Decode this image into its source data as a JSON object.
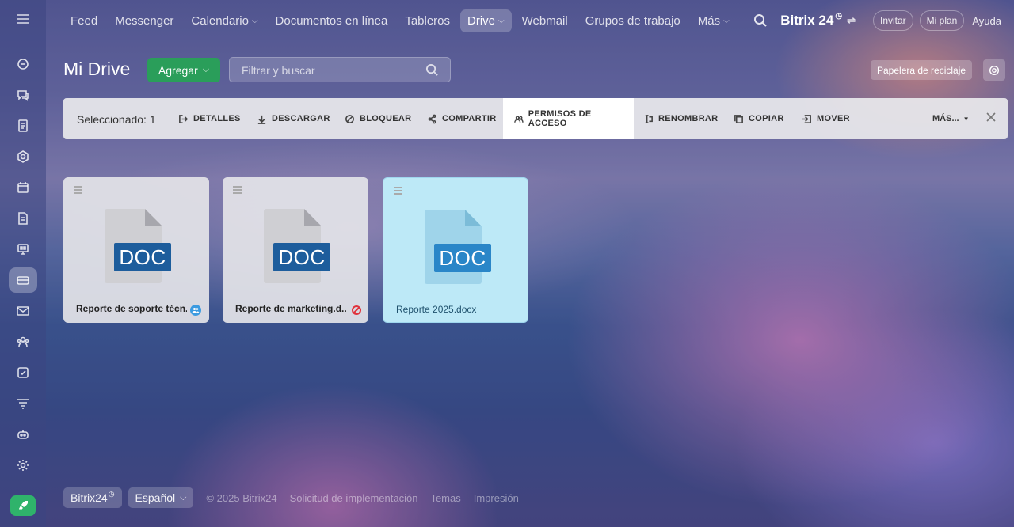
{
  "nav": {
    "items": [
      {
        "label": "Feed",
        "chevron": false
      },
      {
        "label": "Messenger",
        "chevron": false
      },
      {
        "label": "Calendario",
        "chevron": true
      },
      {
        "label": "Documentos en línea",
        "chevron": false
      },
      {
        "label": "Tableros",
        "chevron": false
      },
      {
        "label": "Drive",
        "chevron": true,
        "active": true
      },
      {
        "label": "Webmail",
        "chevron": false
      },
      {
        "label": "Grupos de trabajo",
        "chevron": false
      },
      {
        "label": "Más",
        "chevron": true
      }
    ],
    "brand": "Bitrix 24",
    "invite": "Invitar",
    "my_plan": "Mi plan",
    "help": "Ayuda"
  },
  "sidebar": {
    "icons": [
      "menu-icon",
      "feed-icon",
      "chat-icon",
      "docs-icon",
      "sites-icon",
      "calendar-icon",
      "document-icon",
      "boards-icon",
      "drive-icon",
      "mail-icon",
      "groups-icon",
      "tasks-icon",
      "filter-icon",
      "robot-icon",
      "settings-icon"
    ],
    "active": "drive-icon"
  },
  "page": {
    "title": "Mi Drive",
    "add_button": "Agregar",
    "filter_placeholder": "Filtrar y buscar",
    "trash_button": "Papelera de reciclaje"
  },
  "toolbar": {
    "selected_label": "Seleccionado: 1",
    "actions": {
      "details": "DETALLES",
      "download": "DESCARGAR",
      "lock": "BLOQUEAR",
      "share": "COMPARTIR",
      "permissions": "PERMISOS DE ACCESO",
      "rename": "RENOMBRAR",
      "copy": "COPIAR",
      "move": "MOVER"
    },
    "more": "MÁS..."
  },
  "files": [
    {
      "name": "Reporte de soporte técn...",
      "type": "DOC",
      "status": "shared",
      "selected": false
    },
    {
      "name": "Reporte de marketing.d...",
      "type": "DOC",
      "status": "locked",
      "selected": false
    },
    {
      "name": "Reporte 2025.docx",
      "type": "DOC",
      "status": "",
      "selected": true
    }
  ],
  "footer": {
    "brand": "Bitrix24",
    "language": "Español",
    "copyright": "© 2025 Bitrix24",
    "links": [
      "Solicitud de implementación",
      "Temas",
      "Impresión"
    ]
  },
  "colors": {
    "accent_green": "#2a9e5a",
    "doc_blue": "#1d5d9c",
    "selected_tile": "#bde9f7",
    "locked_red": "#e0323c",
    "shared_blue": "#3c9be0"
  }
}
